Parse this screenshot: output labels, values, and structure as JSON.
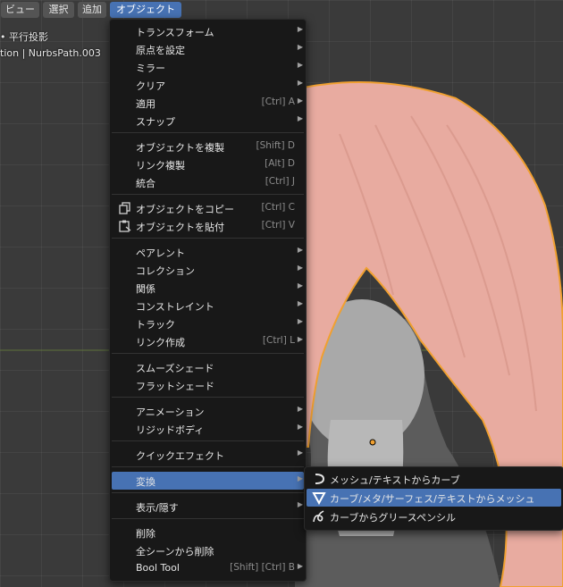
{
  "header": {
    "buttons": [
      {
        "label": "ビュー"
      },
      {
        "label": "選択"
      },
      {
        "label": "追加"
      },
      {
        "label": "オブジェクト"
      }
    ]
  },
  "viewport": {
    "line1": "• 平行投影",
    "line2": "tion | NurbsPath.003"
  },
  "menu": {
    "items": [
      {
        "label": "トランスフォーム",
        "shortcut": "",
        "arrow": "▶"
      },
      {
        "label": "原点を設定",
        "shortcut": "",
        "arrow": "▶"
      },
      {
        "label": "ミラー",
        "shortcut": "",
        "arrow": "▶"
      },
      {
        "label": "クリア",
        "shortcut": "",
        "arrow": "▶"
      },
      {
        "label": "適用",
        "shortcut": "[Ctrl] A",
        "arrow": "▶"
      },
      {
        "label": "スナップ",
        "shortcut": "",
        "arrow": "▶"
      },
      {
        "label": "オブジェクトを複製",
        "shortcut": "[Shift] D",
        "arrow": ""
      },
      {
        "label": "リンク複製",
        "shortcut": "[Alt] D",
        "arrow": ""
      },
      {
        "label": "統合",
        "shortcut": "[Ctrl] J",
        "arrow": ""
      },
      {
        "label": "オブジェクトをコピー",
        "shortcut": "[Ctrl] C",
        "arrow": "",
        "icon": "copy-icon"
      },
      {
        "label": "オブジェクトを貼付",
        "shortcut": "[Ctrl] V",
        "arrow": "",
        "icon": "paste-icon"
      },
      {
        "label": "ペアレント",
        "shortcut": "",
        "arrow": "▶"
      },
      {
        "label": "コレクション",
        "shortcut": "",
        "arrow": "▶"
      },
      {
        "label": "関係",
        "shortcut": "",
        "arrow": "▶"
      },
      {
        "label": "コンストレイント",
        "shortcut": "",
        "arrow": "▶"
      },
      {
        "label": "トラック",
        "shortcut": "",
        "arrow": "▶"
      },
      {
        "label": "リンク作成",
        "shortcut": "[Ctrl] L",
        "arrow": "▶"
      },
      {
        "label": "スムーズシェード",
        "shortcut": "",
        "arrow": ""
      },
      {
        "label": "フラットシェード",
        "shortcut": "",
        "arrow": ""
      },
      {
        "label": "アニメーション",
        "shortcut": "",
        "arrow": "▶"
      },
      {
        "label": "リジッドボディ",
        "shortcut": "",
        "arrow": "▶"
      },
      {
        "label": "クイックエフェクト",
        "shortcut": "",
        "arrow": "▶"
      },
      {
        "label": "変換",
        "shortcut": "",
        "arrow": "▶",
        "highlighted": true
      },
      {
        "label": "表示/隠す",
        "shortcut": "",
        "arrow": "▶"
      },
      {
        "label": "削除",
        "shortcut": "",
        "arrow": ""
      },
      {
        "label": "全シーンから削除",
        "shortcut": "",
        "arrow": ""
      },
      {
        "label": "Bool Tool",
        "shortcut": "[Shift] [Ctrl] B",
        "arrow": "▶"
      }
    ]
  },
  "submenu": {
    "items": [
      {
        "label": "メッシュ/テキストからカーブ",
        "icon": "curve-icon"
      },
      {
        "label": "カーブ/メタ/サーフェス/テキストからメッシュ",
        "icon": "mesh-icon",
        "highlighted": true
      },
      {
        "label": "カーブからグリースペンシル",
        "icon": "grease-pencil-icon"
      }
    ]
  },
  "colors": {
    "accent": "#4772b3",
    "menu_bg": "#181818",
    "hair": "#e8aba0",
    "selection_outline": "#f0a030"
  }
}
